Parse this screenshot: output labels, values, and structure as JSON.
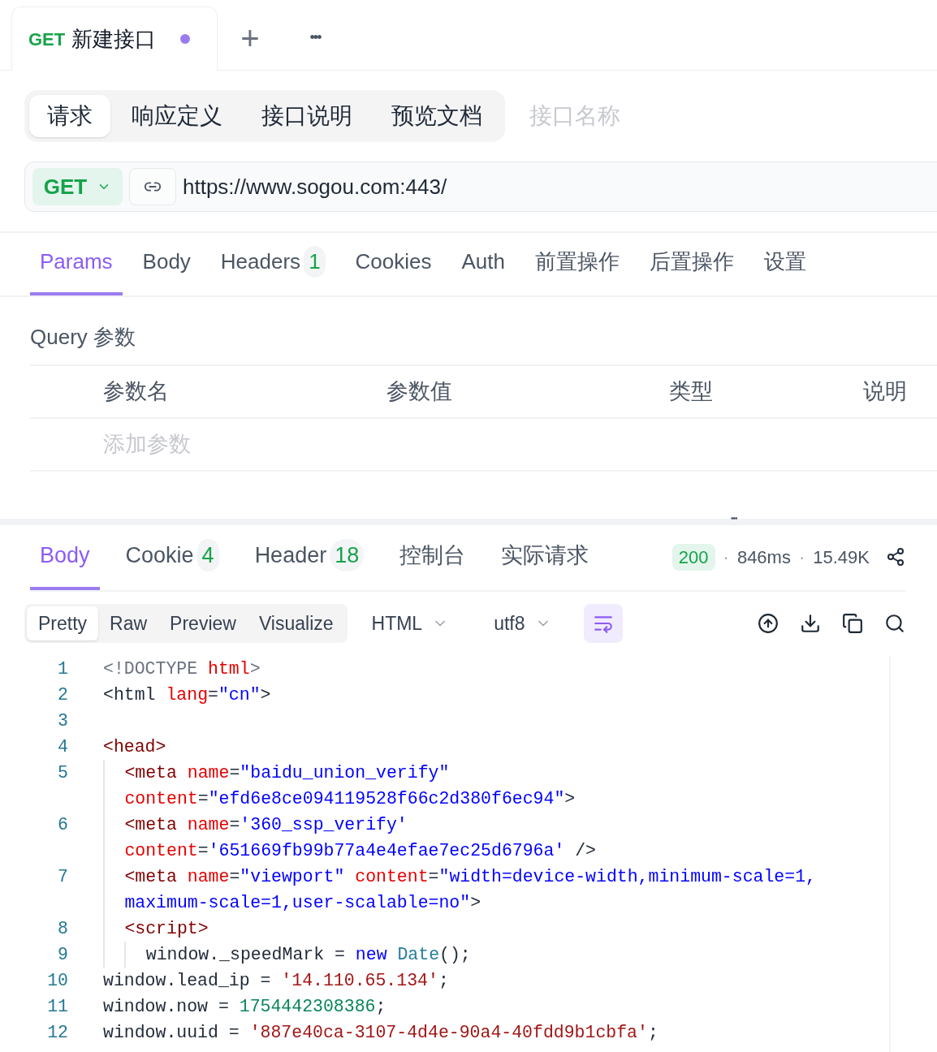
{
  "doc_tabs": [
    {
      "method": "GET",
      "title": "新建接口",
      "unsaved": true,
      "selected": true
    }
  ],
  "tab_actions": {
    "add": "+",
    "more": "•••"
  },
  "mode_tabs": [
    {
      "label": "请求",
      "selected": true
    },
    {
      "label": "响应定义",
      "selected": false
    },
    {
      "label": "接口说明",
      "selected": false
    },
    {
      "label": "预览文档",
      "selected": false
    }
  ],
  "name_field": {
    "placeholder": "接口名称"
  },
  "request": {
    "method": "GET",
    "url": "https://www.sogou.com:443/"
  },
  "request_tabs": [
    {
      "label": "Params",
      "selected": true
    },
    {
      "label": "Body",
      "selected": false
    },
    {
      "label": "Headers",
      "count": "1",
      "selected": false
    },
    {
      "label": "Cookies",
      "selected": false
    },
    {
      "label": "Auth",
      "selected": false
    },
    {
      "label": "前置操作",
      "selected": false
    },
    {
      "label": "后置操作",
      "selected": false
    },
    {
      "label": "设置",
      "selected": false
    }
  ],
  "query": {
    "title": "Query 参数",
    "columns": [
      "参数名",
      "参数值",
      "类型",
      "说明"
    ],
    "add_placeholder": "添加参数"
  },
  "splitter": "•••",
  "response_tabs": [
    {
      "label": "Body",
      "selected": true
    },
    {
      "label": "Cookie",
      "count": "4",
      "selected": false
    },
    {
      "label": "Header",
      "count": "18",
      "selected": false
    },
    {
      "label": "控制台",
      "selected": false
    },
    {
      "label": "实际请求",
      "selected": false
    }
  ],
  "response_meta": {
    "status": "200",
    "separator": "·",
    "time": "846ms",
    "size": "15.49K"
  },
  "view_tabs": [
    {
      "label": "Pretty",
      "selected": true
    },
    {
      "label": "Raw",
      "selected": false
    },
    {
      "label": "Preview",
      "selected": false
    },
    {
      "label": "Visualize",
      "selected": false
    }
  ],
  "format": "HTML",
  "encoding": "utf8",
  "wrap_on": true,
  "code": [
    {
      "number": "1",
      "kind": "top",
      "rows": [
        {
          "segments": [
            {
              "kind": "doctype",
              "text": "<!DOCTYPE "
            },
            {
              "kind": "attr",
              "text": "html"
            },
            {
              "kind": "doctype",
              "text": ">"
            }
          ]
        }
      ]
    },
    {
      "number": "2",
      "kind": "top",
      "rows": [
        {
          "segments": [
            {
              "kind": "plain",
              "text": "<html "
            },
            {
              "kind": "attr",
              "text": "lang"
            },
            {
              "kind": "plain",
              "text": "="
            },
            {
              "kind": "attrval",
              "text": "\"cn\""
            },
            {
              "kind": "plain",
              "text": ">"
            }
          ]
        }
      ]
    },
    {
      "number": "3",
      "kind": "top",
      "rows": [
        {
          "segments": []
        }
      ]
    },
    {
      "number": "4",
      "kind": "top",
      "rows": [
        {
          "segments": [
            {
              "kind": "tag",
              "text": "<head>"
            }
          ]
        }
      ]
    },
    {
      "number": "5",
      "kind": "head",
      "rows": [
        {
          "segments": [
            {
              "kind": "tag",
              "text": "<meta "
            },
            {
              "kind": "attr",
              "text": "name"
            },
            {
              "kind": "plain",
              "text": "="
            },
            {
              "kind": "attrval",
              "text": "\"baidu_union_verify\""
            }
          ]
        },
        {
          "segments": [
            {
              "kind": "attr",
              "text": "content"
            },
            {
              "kind": "plain",
              "text": "="
            },
            {
              "kind": "attrval",
              "text": "\"efd6e8ce094119528f66c2d380f6ec94\""
            },
            {
              "kind": "plain",
              "text": ">"
            }
          ]
        }
      ]
    },
    {
      "number": "6",
      "kind": "head",
      "rows": [
        {
          "segments": [
            {
              "kind": "tag",
              "text": "<meta "
            },
            {
              "kind": "attr",
              "text": "name"
            },
            {
              "kind": "plain",
              "text": "="
            },
            {
              "kind": "attrval",
              "text": "'360_ssp_verify'"
            }
          ]
        },
        {
          "segments": [
            {
              "kind": "attr",
              "text": "content"
            },
            {
              "kind": "plain",
              "text": "="
            },
            {
              "kind": "attrval",
              "text": "'651669fb99b77a4e4efae7ec25d6796a'"
            },
            {
              "kind": "plain",
              "text": " />"
            }
          ]
        }
      ]
    },
    {
      "number": "7",
      "kind": "head",
      "rows": [
        {
          "segments": [
            {
              "kind": "tag",
              "text": "<meta "
            },
            {
              "kind": "attr",
              "text": "name"
            },
            {
              "kind": "plain",
              "text": "="
            },
            {
              "kind": "attrval",
              "text": "\"viewport\""
            },
            {
              "kind": "attr",
              "text": " content"
            },
            {
              "kind": "plain",
              "text": "="
            },
            {
              "kind": "attrval",
              "text": "\"width=device-width,minimum-scale=1,"
            }
          ]
        },
        {
          "segments": [
            {
              "kind": "attrval",
              "text": "maximum-scale=1,user-scalable=no\""
            },
            {
              "kind": "plain",
              "text": ">"
            }
          ]
        }
      ]
    },
    {
      "number": "8",
      "kind": "head",
      "rows": [
        {
          "segments": [
            {
              "kind": "tag",
              "text": "<script>"
            }
          ]
        }
      ]
    },
    {
      "number": "9",
      "kind": "script",
      "rows": [
        {
          "segments": [
            {
              "kind": "plain",
              "text": "window._speedMark = "
            },
            {
              "kind": "keyword",
              "text": "new "
            },
            {
              "kind": "type",
              "text": "Date"
            },
            {
              "kind": "plain",
              "text": "();"
            }
          ]
        }
      ]
    },
    {
      "number": "10",
      "kind": "top",
      "rows": [
        {
          "segments": [
            {
              "kind": "plain",
              "text": "window.lead_ip = "
            },
            {
              "kind": "string",
              "text": "'14.110.65.134'"
            },
            {
              "kind": "plain",
              "text": ";"
            }
          ]
        }
      ]
    },
    {
      "number": "11",
      "kind": "top",
      "rows": [
        {
          "segments": [
            {
              "kind": "plain",
              "text": "window.now = "
            },
            {
              "kind": "number",
              "text": "1754442308386"
            },
            {
              "kind": "plain",
              "text": ";"
            }
          ]
        }
      ]
    },
    {
      "number": "12",
      "kind": "top",
      "rows": [
        {
          "segments": [
            {
              "kind": "plain",
              "text": "window.uuid = "
            },
            {
              "kind": "string",
              "text": "'887e40ca-3107-4d4e-90a4-40fdd9b1cbfa'"
            },
            {
              "kind": "plain",
              "text": ";"
            }
          ]
        }
      ]
    }
  ]
}
